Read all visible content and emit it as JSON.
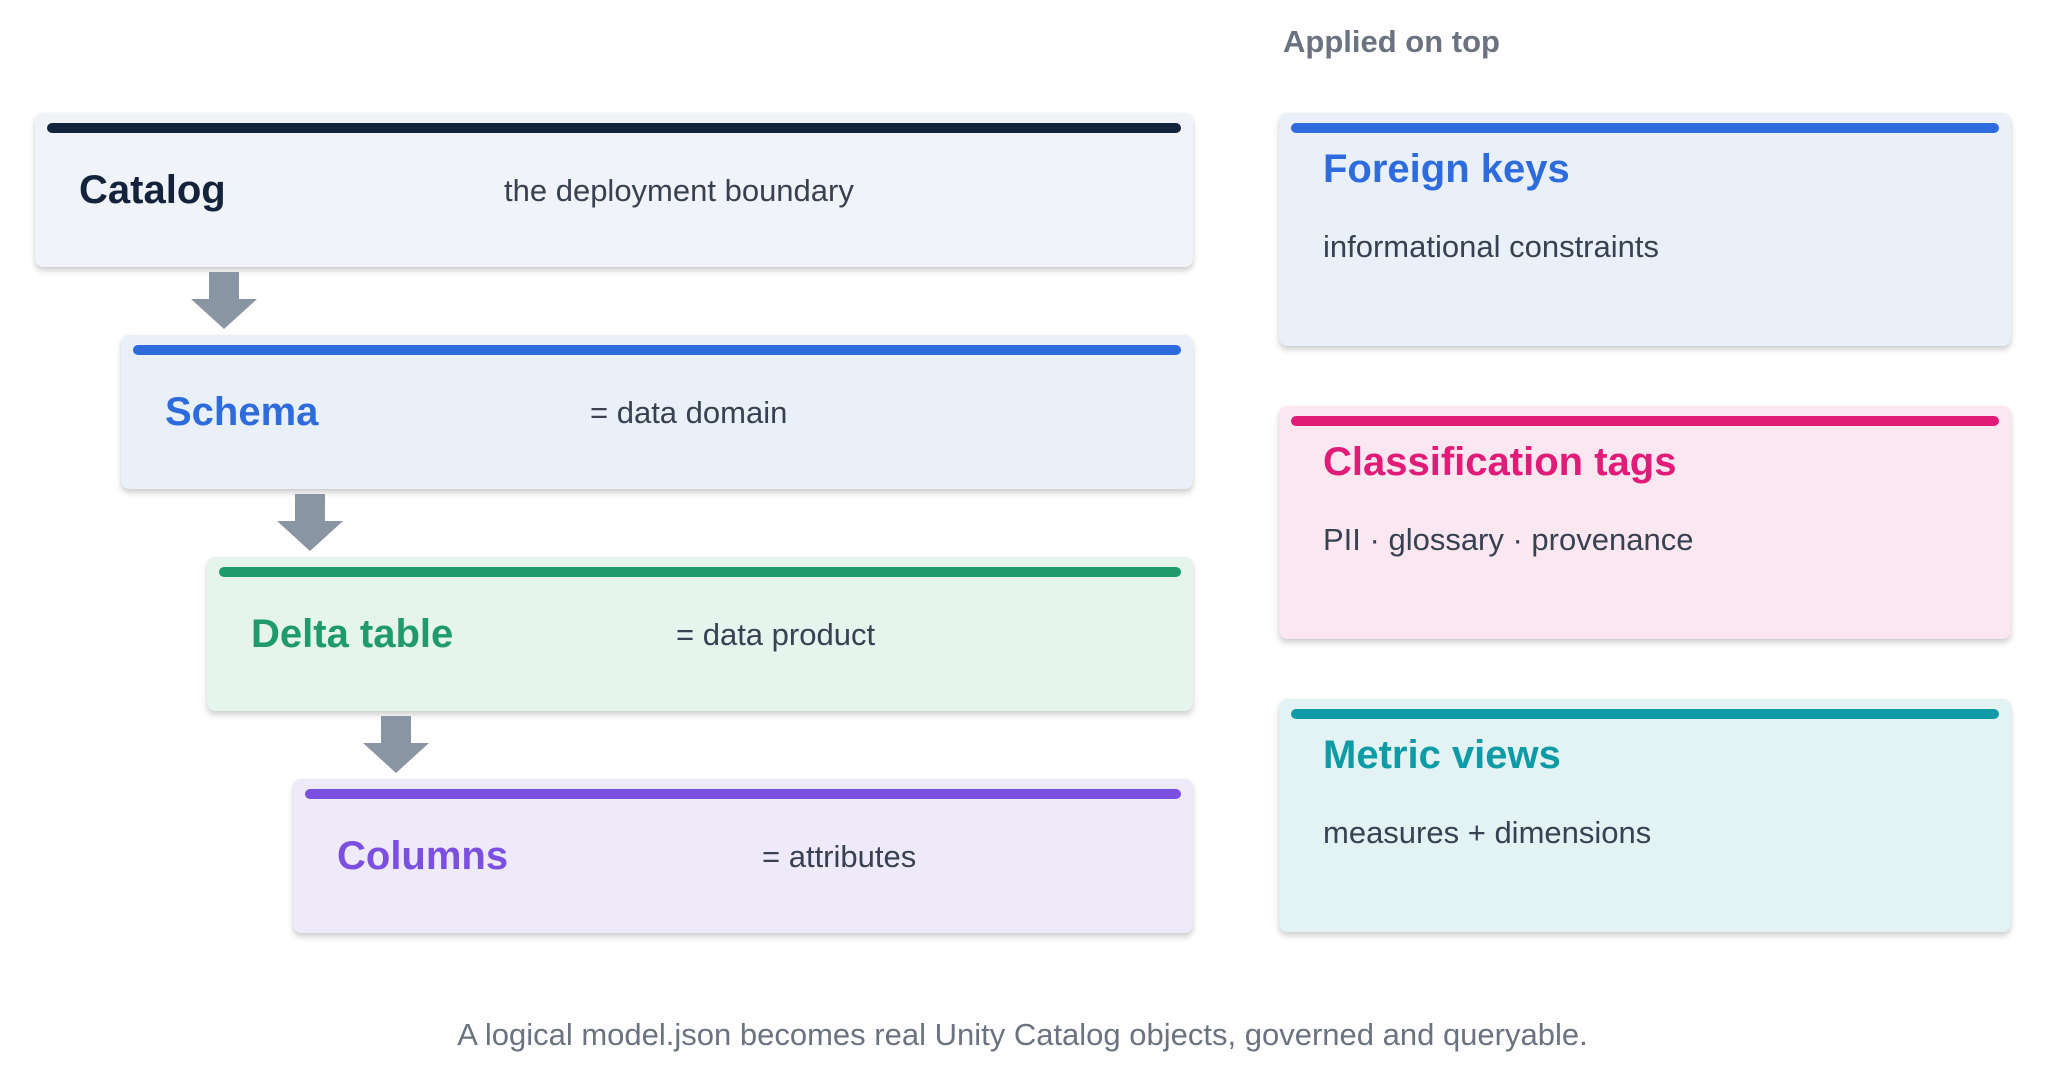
{
  "hierarchy": [
    {
      "title": "Catalog",
      "description": "the deployment boundary",
      "accent": "#13233b",
      "background": "#f0f3f7"
    },
    {
      "title": "Schema",
      "description": "= data domain",
      "accent": "#2e6bdc",
      "background": "#eaf0fa"
    },
    {
      "title": "Delta table",
      "description": "= data product",
      "accent": "#1f9a6a",
      "background": "#e6f4ee"
    },
    {
      "title": "Columns",
      "description": "= attributes",
      "accent": "#7b4fe0",
      "background": "#efeaf9"
    }
  ],
  "applied": {
    "heading": "Applied on top",
    "items": [
      {
        "title": "Foreign keys",
        "description": "informational constraints",
        "accent": "#2e6bdc",
        "background": "#eaf0fa"
      },
      {
        "title": "Classification tags",
        "description": "PII · glossary · provenance",
        "accent": "#e01b78",
        "background": "#fbe7f0"
      },
      {
        "title": "Metric views",
        "description": "measures + dimensions",
        "accent": "#0f9ba6",
        "background": "#e3f3f4"
      }
    ]
  },
  "arrow_color": "#8a95a3",
  "caption": "A logical model.json becomes real Unity Catalog objects, governed and queryable."
}
